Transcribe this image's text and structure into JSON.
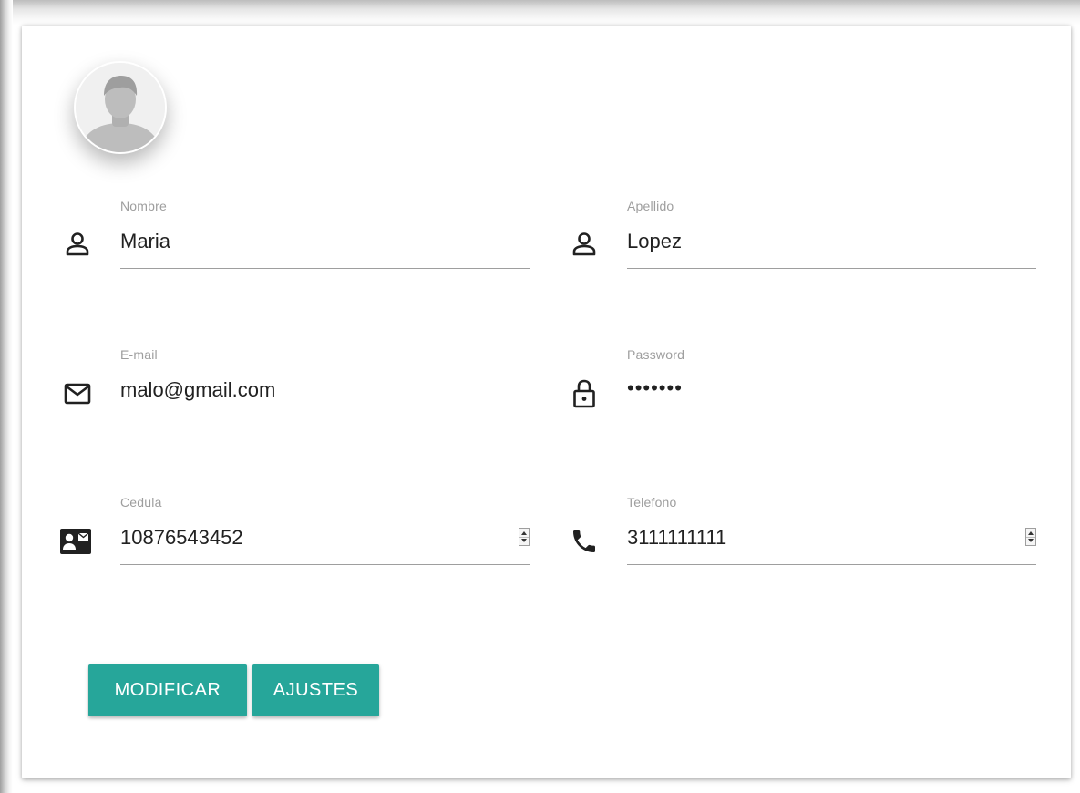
{
  "form": {
    "fields": {
      "nombre": {
        "label": "Nombre",
        "value": "Maria",
        "icon": "person-icon"
      },
      "apellido": {
        "label": "Apellido",
        "value": "Lopez",
        "icon": "person-icon"
      },
      "email": {
        "label": "E-mail",
        "value": "malo@gmail.com",
        "icon": "mail-icon"
      },
      "password": {
        "label": "Password",
        "value": "•••••••",
        "icon": "lock-icon"
      },
      "cedula": {
        "label": "Cedula",
        "value": "10876543452",
        "icon": "contact-card-icon"
      },
      "telefono": {
        "label": "Telefono",
        "value": "3111111111",
        "icon": "phone-icon"
      }
    }
  },
  "buttons": {
    "modificar": "MODIFICAR",
    "ajustes": "AJUSTES"
  },
  "colors": {
    "accent": "#26a69a",
    "label": "#9e9e9e",
    "text": "#212121"
  }
}
